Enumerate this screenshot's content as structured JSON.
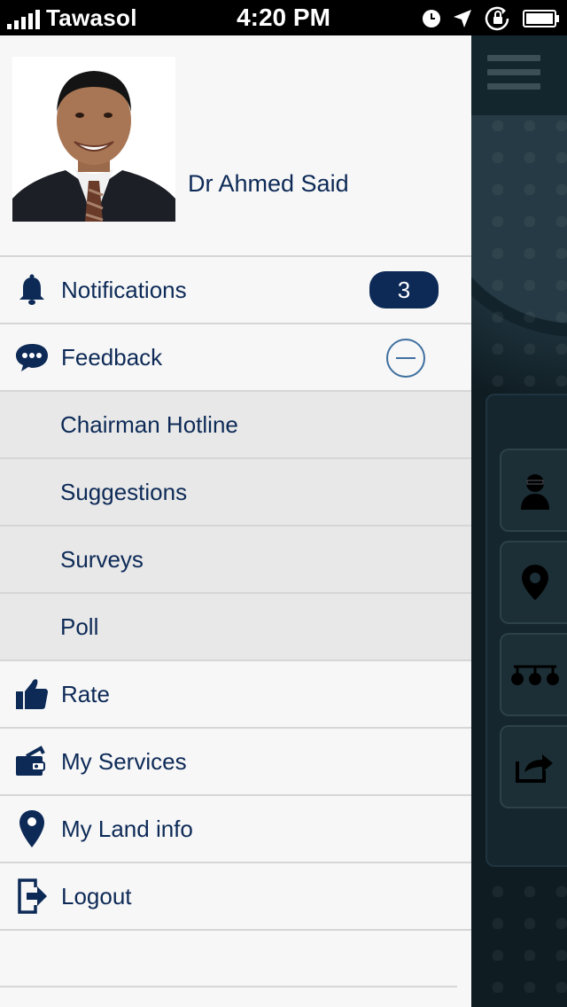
{
  "status_bar": {
    "carrier": "Tawasol",
    "time": "4:20 PM"
  },
  "profile": {
    "name": "Dr Ahmed Said"
  },
  "menu": {
    "notifications": {
      "label": "Notifications",
      "badge": "3",
      "icon": "bell-icon"
    },
    "feedback": {
      "label": "Feedback",
      "icon": "chat-bubble-icon",
      "expanded": true
    },
    "feedback_items": [
      {
        "label": "Chairman Hotline"
      },
      {
        "label": "Suggestions"
      },
      {
        "label": "Surveys"
      },
      {
        "label": "Poll"
      }
    ],
    "rate": {
      "label": "Rate",
      "icon": "thumbs-up-icon"
    },
    "my_services": {
      "label": "My Services",
      "icon": "wallet-icon"
    },
    "my_land_info": {
      "label": "My Land info",
      "icon": "map-pin-icon"
    },
    "logout": {
      "label": "Logout",
      "icon": "logout-icon"
    }
  },
  "colors": {
    "navy": "#0d2a57",
    "drawer_bg": "#f7f7f7",
    "sub_bg": "#e8e8e8",
    "background_app": "#0f1c22"
  }
}
